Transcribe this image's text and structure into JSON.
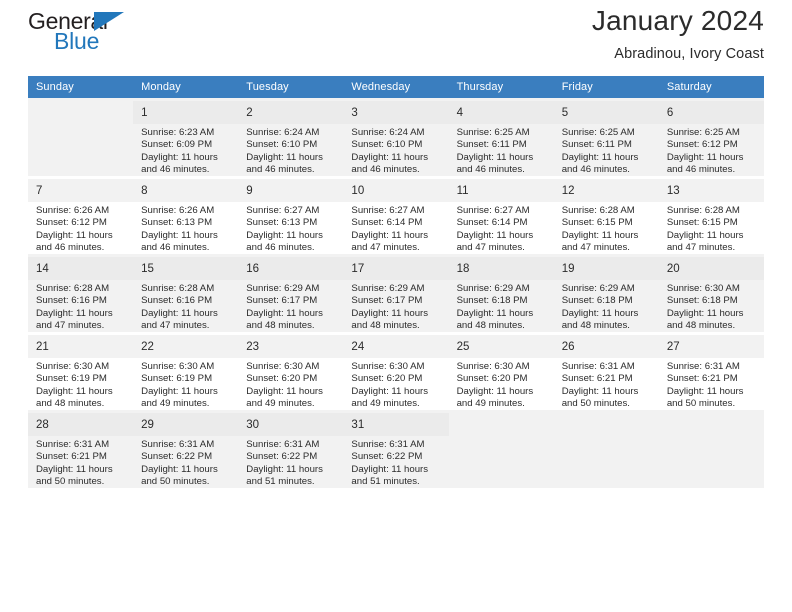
{
  "brand": {
    "name_top": "General",
    "name_bottom": "Blue",
    "triangle_color": "#2277bb",
    "text_color": "#231f20"
  },
  "header": {
    "title": "January 2024",
    "subtitle": "Abradinou, Ivory Coast",
    "header_bg": "#3a7ebf",
    "header_text_color": "#ffffff"
  },
  "weekday_headers": [
    "Sunday",
    "Monday",
    "Tuesday",
    "Wednesday",
    "Thursday",
    "Friday",
    "Saturday"
  ],
  "weeks": [
    [
      {
        "day": "",
        "lines": []
      },
      {
        "day": "1",
        "lines": [
          "Sunrise: 6:23 AM",
          "Sunset: 6:09 PM",
          "Daylight: 11 hours",
          "and 46 minutes."
        ]
      },
      {
        "day": "2",
        "lines": [
          "Sunrise: 6:24 AM",
          "Sunset: 6:10 PM",
          "Daylight: 11 hours",
          "and 46 minutes."
        ]
      },
      {
        "day": "3",
        "lines": [
          "Sunrise: 6:24 AM",
          "Sunset: 6:10 PM",
          "Daylight: 11 hours",
          "and 46 minutes."
        ]
      },
      {
        "day": "4",
        "lines": [
          "Sunrise: 6:25 AM",
          "Sunset: 6:11 PM",
          "Daylight: 11 hours",
          "and 46 minutes."
        ]
      },
      {
        "day": "5",
        "lines": [
          "Sunrise: 6:25 AM",
          "Sunset: 6:11 PM",
          "Daylight: 11 hours",
          "and 46 minutes."
        ]
      },
      {
        "day": "6",
        "lines": [
          "Sunrise: 6:25 AM",
          "Sunset: 6:12 PM",
          "Daylight: 11 hours",
          "and 46 minutes."
        ]
      }
    ],
    [
      {
        "day": "7",
        "lines": [
          "Sunrise: 6:26 AM",
          "Sunset: 6:12 PM",
          "Daylight: 11 hours",
          "and 46 minutes."
        ]
      },
      {
        "day": "8",
        "lines": [
          "Sunrise: 6:26 AM",
          "Sunset: 6:13 PM",
          "Daylight: 11 hours",
          "and 46 minutes."
        ]
      },
      {
        "day": "9",
        "lines": [
          "Sunrise: 6:27 AM",
          "Sunset: 6:13 PM",
          "Daylight: 11 hours",
          "and 46 minutes."
        ]
      },
      {
        "day": "10",
        "lines": [
          "Sunrise: 6:27 AM",
          "Sunset: 6:14 PM",
          "Daylight: 11 hours",
          "and 47 minutes."
        ]
      },
      {
        "day": "11",
        "lines": [
          "Sunrise: 6:27 AM",
          "Sunset: 6:14 PM",
          "Daylight: 11 hours",
          "and 47 minutes."
        ]
      },
      {
        "day": "12",
        "lines": [
          "Sunrise: 6:28 AM",
          "Sunset: 6:15 PM",
          "Daylight: 11 hours",
          "and 47 minutes."
        ]
      },
      {
        "day": "13",
        "lines": [
          "Sunrise: 6:28 AM",
          "Sunset: 6:15 PM",
          "Daylight: 11 hours",
          "and 47 minutes."
        ]
      }
    ],
    [
      {
        "day": "14",
        "lines": [
          "Sunrise: 6:28 AM",
          "Sunset: 6:16 PM",
          "Daylight: 11 hours",
          "and 47 minutes."
        ]
      },
      {
        "day": "15",
        "lines": [
          "Sunrise: 6:28 AM",
          "Sunset: 6:16 PM",
          "Daylight: 11 hours",
          "and 47 minutes."
        ]
      },
      {
        "day": "16",
        "lines": [
          "Sunrise: 6:29 AM",
          "Sunset: 6:17 PM",
          "Daylight: 11 hours",
          "and 48 minutes."
        ]
      },
      {
        "day": "17",
        "lines": [
          "Sunrise: 6:29 AM",
          "Sunset: 6:17 PM",
          "Daylight: 11 hours",
          "and 48 minutes."
        ]
      },
      {
        "day": "18",
        "lines": [
          "Sunrise: 6:29 AM",
          "Sunset: 6:18 PM",
          "Daylight: 11 hours",
          "and 48 minutes."
        ]
      },
      {
        "day": "19",
        "lines": [
          "Sunrise: 6:29 AM",
          "Sunset: 6:18 PM",
          "Daylight: 11 hours",
          "and 48 minutes."
        ]
      },
      {
        "day": "20",
        "lines": [
          "Sunrise: 6:30 AM",
          "Sunset: 6:18 PM",
          "Daylight: 11 hours",
          "and 48 minutes."
        ]
      }
    ],
    [
      {
        "day": "21",
        "lines": [
          "Sunrise: 6:30 AM",
          "Sunset: 6:19 PM",
          "Daylight: 11 hours",
          "and 48 minutes."
        ]
      },
      {
        "day": "22",
        "lines": [
          "Sunrise: 6:30 AM",
          "Sunset: 6:19 PM",
          "Daylight: 11 hours",
          "and 49 minutes."
        ]
      },
      {
        "day": "23",
        "lines": [
          "Sunrise: 6:30 AM",
          "Sunset: 6:20 PM",
          "Daylight: 11 hours",
          "and 49 minutes."
        ]
      },
      {
        "day": "24",
        "lines": [
          "Sunrise: 6:30 AM",
          "Sunset: 6:20 PM",
          "Daylight: 11 hours",
          "and 49 minutes."
        ]
      },
      {
        "day": "25",
        "lines": [
          "Sunrise: 6:30 AM",
          "Sunset: 6:20 PM",
          "Daylight: 11 hours",
          "and 49 minutes."
        ]
      },
      {
        "day": "26",
        "lines": [
          "Sunrise: 6:31 AM",
          "Sunset: 6:21 PM",
          "Daylight: 11 hours",
          "and 50 minutes."
        ]
      },
      {
        "day": "27",
        "lines": [
          "Sunrise: 6:31 AM",
          "Sunset: 6:21 PM",
          "Daylight: 11 hours",
          "and 50 minutes."
        ]
      }
    ],
    [
      {
        "day": "28",
        "lines": [
          "Sunrise: 6:31 AM",
          "Sunset: 6:21 PM",
          "Daylight: 11 hours",
          "and 50 minutes."
        ]
      },
      {
        "day": "29",
        "lines": [
          "Sunrise: 6:31 AM",
          "Sunset: 6:22 PM",
          "Daylight: 11 hours",
          "and 50 minutes."
        ]
      },
      {
        "day": "30",
        "lines": [
          "Sunrise: 6:31 AM",
          "Sunset: 6:22 PM",
          "Daylight: 11 hours",
          "and 51 minutes."
        ]
      },
      {
        "day": "31",
        "lines": [
          "Sunrise: 6:31 AM",
          "Sunset: 6:22 PM",
          "Daylight: 11 hours",
          "and 51 minutes."
        ]
      },
      {
        "day": "",
        "lines": []
      },
      {
        "day": "",
        "lines": []
      },
      {
        "day": "",
        "lines": []
      }
    ]
  ]
}
